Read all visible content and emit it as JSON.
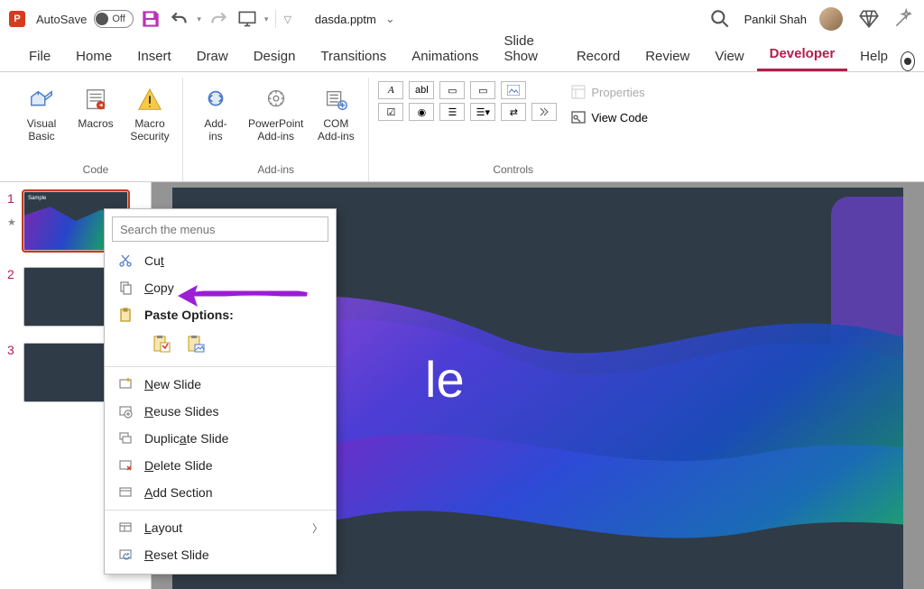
{
  "title_bar": {
    "autosave_label": "AutoSave",
    "autosave_state": "Off",
    "filename": "dasda.pptm",
    "user_name": "Pankil Shah"
  },
  "tabs": {
    "items": [
      "File",
      "Home",
      "Insert",
      "Draw",
      "Design",
      "Transitions",
      "Animations",
      "Slide Show",
      "Record",
      "Review",
      "View",
      "Developer",
      "Help"
    ],
    "active": "Developer"
  },
  "ribbon": {
    "code": {
      "label": "Code",
      "visual_basic": "Visual\nBasic",
      "macros": "Macros",
      "macro_security": "Macro\nSecurity"
    },
    "addins": {
      "label": "Add-ins",
      "addins": "Add-\nins",
      "pp_addins": "PowerPoint\nAdd-ins",
      "com_addins": "COM\nAdd-ins"
    },
    "controls": {
      "label": "Controls",
      "properties": "Properties",
      "view_code": "View Code"
    }
  },
  "thumbs": {
    "items": [
      {
        "num": "1",
        "sample": "Sample"
      },
      {
        "num": "2"
      },
      {
        "num": "3"
      }
    ]
  },
  "slide": {
    "title_fragment": "le"
  },
  "context_menu": {
    "search_placeholder": "Search the menus",
    "cut": "Cut",
    "copy": "Copy",
    "paste_options": "Paste Options:",
    "new_slide": "New Slide",
    "reuse_slides": "Reuse Slides",
    "duplicate_slide": "Duplicate Slide",
    "delete_slide": "Delete Slide",
    "add_section": "Add Section",
    "layout": "Layout",
    "reset_slide": "Reset Slide"
  }
}
